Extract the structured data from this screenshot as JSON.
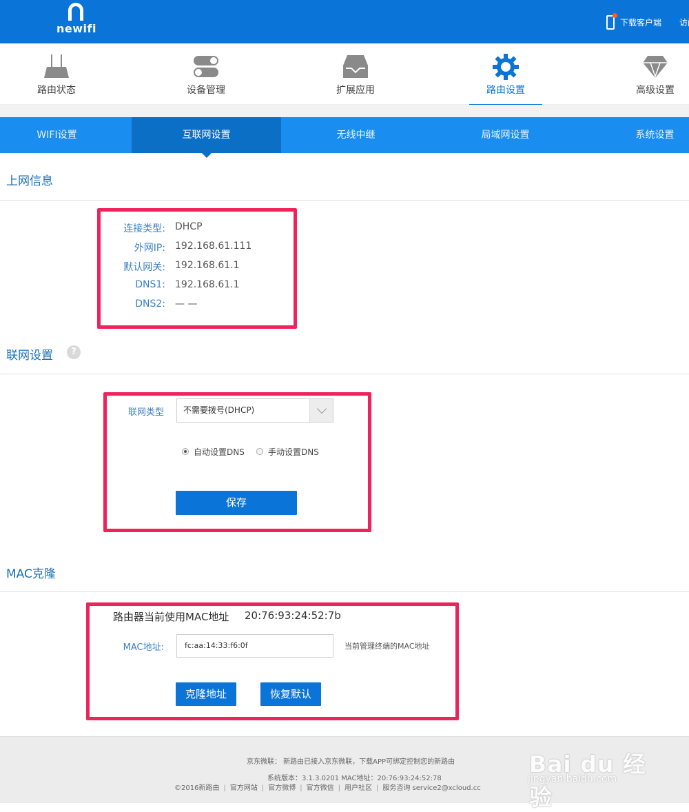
{
  "brand": {
    "logo_text": "newifi"
  },
  "topbar": {
    "download_label": "下载客户端",
    "visit_label": "访问"
  },
  "main_nav": [
    {
      "label": "路由状态",
      "icon": "router-icon",
      "active": false
    },
    {
      "label": "设备管理",
      "icon": "toggle-icon",
      "active": false
    },
    {
      "label": "扩展应用",
      "icon": "extension-tray-icon",
      "active": false
    },
    {
      "label": "路由设置",
      "icon": "gear-icon",
      "active": true
    },
    {
      "label": "高级设置",
      "icon": "diamond-icon",
      "active": false
    }
  ],
  "sub_nav": [
    {
      "label": "WIFI设置",
      "active": false
    },
    {
      "label": "互联网设置",
      "active": true
    },
    {
      "label": "无线中继",
      "active": false
    },
    {
      "label": "局域网设置",
      "active": false
    },
    {
      "label": "系统设置",
      "active": false
    }
  ],
  "internet_info": {
    "title": "上网信息",
    "rows": [
      {
        "label": "连接类型:",
        "value": "DHCP"
      },
      {
        "label": "外网IP:",
        "value": "192.168.61.111"
      },
      {
        "label": "默认网关:",
        "value": "192.168.61.1"
      },
      {
        "label": "DNS1:",
        "value": "192.168.61.1"
      },
      {
        "label": "DNS2:",
        "value": "— —"
      }
    ]
  },
  "network_settings": {
    "title": "联网设置",
    "help_glyph": "?",
    "type_label": "联网类型",
    "type_value": "不需要拨号(DHCP)",
    "dns_auto_label": "自动设置DNS",
    "dns_manual_label": "手动设置DNS",
    "dns_auto_checked": true,
    "save_label": "保存"
  },
  "mac_clone": {
    "title": "MAC克隆",
    "current_label": "路由器当前使用MAC地址",
    "current_value": "20:76:93:24:52:7b",
    "mac_label": "MAC地址:",
    "mac_value": "fc:aa:14:33:f6:0f",
    "hint": "当前管理终端的MAC地址",
    "clone_label": "克隆地址",
    "restore_label": "恢复默认"
  },
  "footer": {
    "line1": "京东微联： 新路由已接入京东微联，下载APP可绑定控制您的新路由",
    "line2": "系统版本：3.1.3.0201   MAC地址：20:76:93:24:52:78",
    "links": [
      "©2016新路由",
      "官方网站",
      "官方微博",
      "官方微信",
      "用户社区",
      "服务咨询 service2@xcloud.cc"
    ]
  },
  "watermark": {
    "main": "Bai du 经验",
    "sub": "jingyan.baidu.com"
  },
  "colors": {
    "brand_blue": "#0a74d8",
    "subnav_blue": "#1a8ef0",
    "highlight_red": "#f0225c"
  }
}
